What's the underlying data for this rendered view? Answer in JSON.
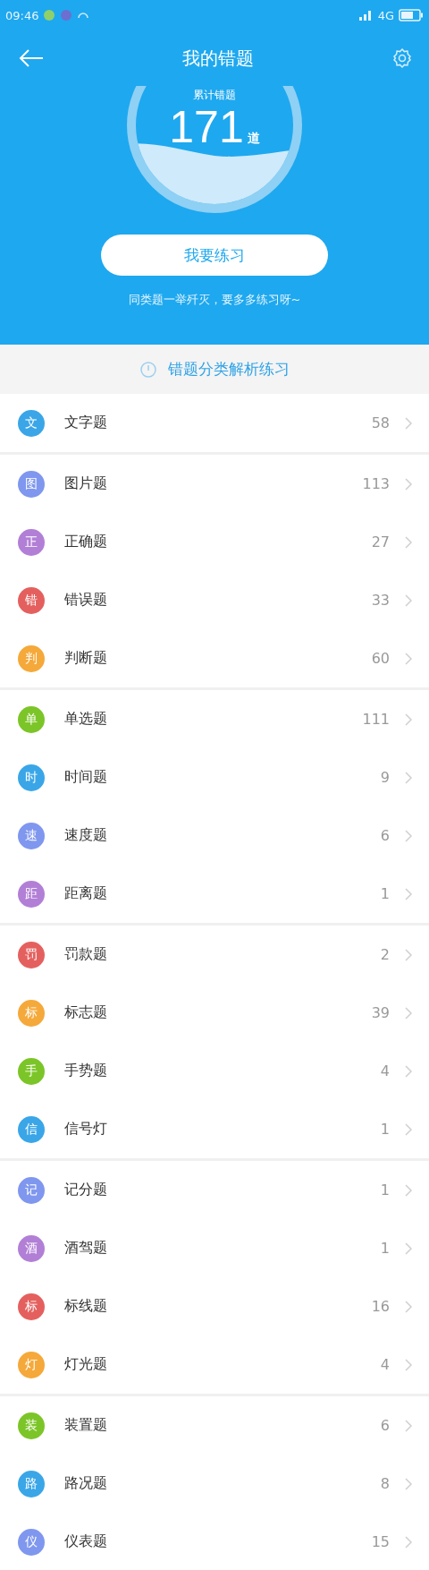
{
  "status_bar": {
    "time": "09:46",
    "network": "4G"
  },
  "header": {
    "title": "我的错题"
  },
  "summary": {
    "label": "累计错题",
    "count": "171",
    "unit": "道",
    "button": "我要练习",
    "note": "同类题一举歼灭，要多多练习呀~"
  },
  "section": {
    "title": "错题分类解析练习"
  },
  "groups": [
    {
      "items": [
        {
          "badge": "文",
          "label": "文字题",
          "count": "58",
          "color": "#3aa6e8"
        }
      ]
    },
    {
      "items": [
        {
          "badge": "图",
          "label": "图片题",
          "count": "113",
          "color": "#7f97ee"
        },
        {
          "badge": "正",
          "label": "正确题",
          "count": "27",
          "color": "#b27fd6"
        },
        {
          "badge": "错",
          "label": "错误题",
          "count": "33",
          "color": "#e4605e"
        },
        {
          "badge": "判",
          "label": "判断题",
          "count": "60",
          "color": "#f5a93a"
        }
      ]
    },
    {
      "items": [
        {
          "badge": "单",
          "label": "单选题",
          "count": "111",
          "color": "#7cc528"
        },
        {
          "badge": "时",
          "label": "时间题",
          "count": "9",
          "color": "#3aa6e8"
        },
        {
          "badge": "速",
          "label": "速度题",
          "count": "6",
          "color": "#7f97ee"
        },
        {
          "badge": "距",
          "label": "距离题",
          "count": "1",
          "color": "#b27fd6"
        }
      ]
    },
    {
      "items": [
        {
          "badge": "罚",
          "label": "罚款题",
          "count": "2",
          "color": "#e4605e"
        },
        {
          "badge": "标",
          "label": "标志题",
          "count": "39",
          "color": "#f5a93a"
        },
        {
          "badge": "手",
          "label": "手势题",
          "count": "4",
          "color": "#7cc528"
        },
        {
          "badge": "信",
          "label": "信号灯",
          "count": "1",
          "color": "#3aa6e8"
        }
      ]
    },
    {
      "items": [
        {
          "badge": "记",
          "label": "记分题",
          "count": "1",
          "color": "#7f97ee"
        },
        {
          "badge": "酒",
          "label": "酒驾题",
          "count": "1",
          "color": "#b27fd6"
        },
        {
          "badge": "标",
          "label": "标线题",
          "count": "16",
          "color": "#e4605e"
        },
        {
          "badge": "灯",
          "label": "灯光题",
          "count": "4",
          "color": "#f5a93a"
        }
      ]
    },
    {
      "items": [
        {
          "badge": "装",
          "label": "装置题",
          "count": "6",
          "color": "#7cc528"
        },
        {
          "badge": "路",
          "label": "路况题",
          "count": "8",
          "color": "#3aa6e8"
        },
        {
          "badge": "仪",
          "label": "仪表题",
          "count": "15",
          "color": "#7f97ee"
        }
      ]
    }
  ]
}
